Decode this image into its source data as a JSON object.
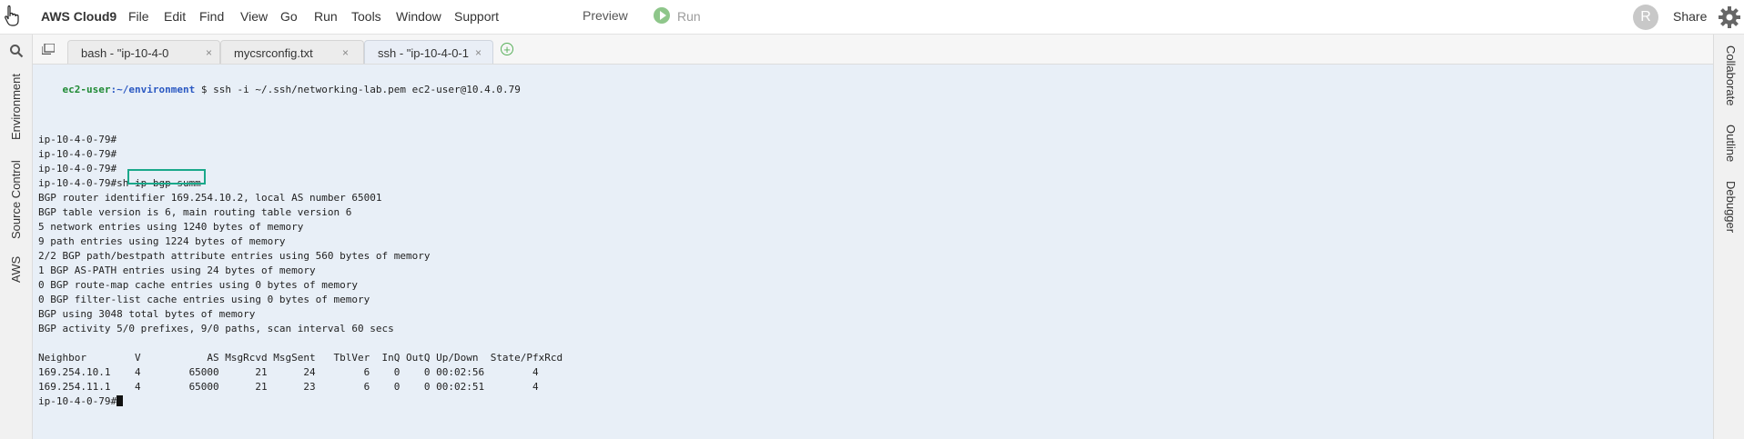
{
  "menubar": {
    "brand": "AWS Cloud9",
    "items": [
      "File",
      "Edit",
      "Find",
      "View",
      "Go",
      "Run",
      "Tools",
      "Window",
      "Support"
    ],
    "preview": "Preview",
    "run": "Run",
    "avatar_initial": "R",
    "share": "Share"
  },
  "leftbar": {
    "tabs": [
      "Environment",
      "Source Control",
      "AWS"
    ]
  },
  "rightbar": {
    "tabs": [
      "Collaborate",
      "Outline",
      "Debugger"
    ]
  },
  "tabs": [
    {
      "label": "bash - \"ip-10-4-0",
      "close": "×"
    },
    {
      "label": "mycsrconfig.txt",
      "close": "×"
    },
    {
      "label": "ssh - \"ip-10-4-0-1",
      "close": "×"
    }
  ],
  "terminal": {
    "prompt_user": "ec2-user",
    "prompt_path": ":~/environment",
    "prompt_cmd": " $ ssh -i ~/.ssh/networking-lab.pem ec2-user@10.4.0.79",
    "lines": [
      "ip-10-4-0-79#",
      "ip-10-4-0-79#",
      "ip-10-4-0-79#",
      "ip-10-4-0-79#sh ip bgp summ",
      "BGP router identifier 169.254.10.2, local AS number 65001",
      "BGP table version is 6, main routing table version 6",
      "5 network entries using 1240 bytes of memory",
      "9 path entries using 1224 bytes of memory",
      "2/2 BGP path/bestpath attribute entries using 560 bytes of memory",
      "1 BGP AS-PATH entries using 24 bytes of memory",
      "0 BGP route-map cache entries using 0 bytes of memory",
      "0 BGP filter-list cache entries using 0 bytes of memory",
      "BGP using 3048 total bytes of memory",
      "BGP activity 5/0 prefixes, 9/0 paths, scan interval 60 secs",
      "",
      "Neighbor        V           AS MsgRcvd MsgSent   TblVer  InQ OutQ Up/Down  State/PfxRcd",
      "169.254.10.1    4        65000      21      24        6    0    0 00:02:56        4",
      "169.254.11.1    4        65000      21      23        6    0    0 00:02:51        4"
    ],
    "last_prompt": "ip-10-4-0-79#"
  }
}
